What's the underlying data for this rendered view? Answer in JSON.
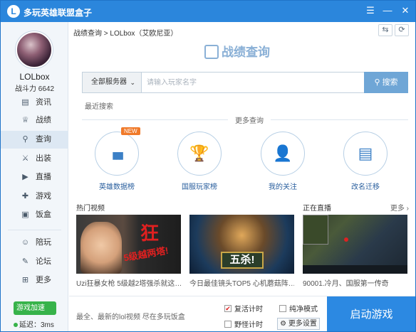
{
  "app": {
    "title": "多玩英雄联盟盒子",
    "logo_text": "L"
  },
  "window_buttons": {
    "menu": "☰",
    "minimize": "—",
    "close": "✕"
  },
  "user": {
    "name": "LOLbox",
    "power": "战斗力 6642"
  },
  "nav": [
    {
      "label": "资讯",
      "icon": "news-icon",
      "glyph": "▤"
    },
    {
      "label": "战绩",
      "icon": "trophy-icon",
      "glyph": "♕"
    },
    {
      "label": "查询",
      "icon": "search-icon",
      "glyph": "⚲"
    },
    {
      "label": "出装",
      "icon": "equipment-icon",
      "glyph": "⚔"
    },
    {
      "label": "直播",
      "icon": "live-icon",
      "glyph": "▶"
    },
    {
      "label": "游戏",
      "icon": "gamepad-icon",
      "glyph": "✚"
    },
    {
      "label": "饭盒",
      "icon": "video-box-icon",
      "glyph": "▣"
    },
    {
      "label": "陪玩",
      "icon": "companion-icon",
      "glyph": "☺"
    },
    {
      "label": "论坛",
      "icon": "forum-icon",
      "glyph": "✎"
    },
    {
      "label": "更多",
      "icon": "more-grid-icon",
      "glyph": "⊞"
    }
  ],
  "speed": {
    "label": "游戏加速",
    "delay": "延迟：3ms"
  },
  "breadcrumb": "战绩查询 > LOLbox（艾欧尼亚）",
  "header_buttons": {
    "share": "⇆",
    "refresh": "⟳"
  },
  "brand": "战绩查询",
  "search": {
    "server": "全部服务器",
    "placeholder": "请输入玩家名字",
    "button": "搜索",
    "recent": "最近搜索"
  },
  "more_query": "更多查询",
  "query_items": [
    {
      "label": "英雄数据榜",
      "icon": "bar-chart-icon",
      "glyph": "▮▮▮",
      "tag": "NEW"
    },
    {
      "label": "国服玩家榜",
      "icon": "trophy-cup-icon",
      "glyph": "🏆"
    },
    {
      "label": "我的关注",
      "icon": "user-add-icon",
      "glyph": "👤"
    },
    {
      "label": "改名迁移",
      "icon": "document-icon",
      "glyph": "▤"
    }
  ],
  "hot_videos": {
    "title": "热门视频"
  },
  "live": {
    "title": "正在直播",
    "more": "更多 ›"
  },
  "videos": [
    {
      "caption": "Uzi狂暴女枪 5级越2塔强杀就这…",
      "overlay1": "狂",
      "overlay2": "5级越两塔!"
    },
    {
      "caption": "今日最佳镜头TOP5 心机蘑菇阵…",
      "overlay1": "五杀!"
    },
    {
      "caption": "90001.冷月、国服第一传奇"
    }
  ],
  "bottom": {
    "tip": "最全、最新的lol视频 尽在多玩饭盒",
    "checkbox_revive": "复活计时",
    "checkbox_jungle": "野怪计时",
    "checkbox_pure": "纯净模式",
    "settings": "更多设置",
    "launch": "启动游戏"
  }
}
